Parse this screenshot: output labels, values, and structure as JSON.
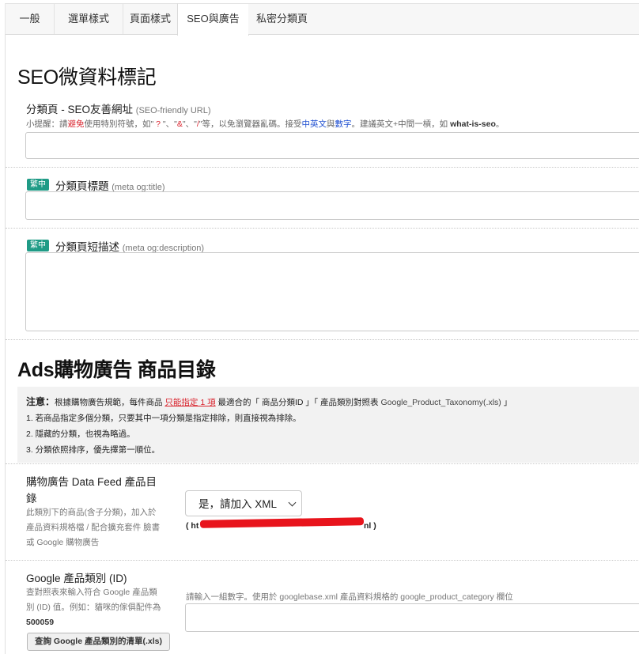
{
  "tabs": [
    {
      "label": "一般",
      "active": false
    },
    {
      "label": "選單樣式",
      "active": false
    },
    {
      "label": "頁面樣式",
      "active": false
    },
    {
      "label": "SEO與廣告",
      "active": true
    },
    {
      "label": "私密分類頁",
      "active": false
    }
  ],
  "seo": {
    "title": "SEO微資料標記",
    "friendly_url": {
      "label": "分類頁 - SEO友善網址",
      "sublabel": "(SEO-friendly URL)",
      "hint": {
        "p1": "小提醒：請",
        "avoid": "避免",
        "p2": "使用特別符號，如\"",
        "q": " ? ",
        "p3": "\"、\"",
        "amp": "&",
        "p4": "\"、\"",
        "slash": "/",
        "p5": "\"等，以免瀏覽器亂碼。接受",
        "cn": "中英文",
        "p6": "與",
        "num": "數字",
        "p7": "。建議英文+中間一槓，如 ",
        "example": "what-is-seo",
        "p8": "。"
      },
      "value": ""
    },
    "page_title": {
      "badge": "繁中",
      "label": "分類頁標題",
      "sublabel": "(meta og:title)",
      "value": ""
    },
    "page_desc": {
      "badge": "繁中",
      "label": "分類頁短描述",
      "sublabel": "(meta og:description)",
      "value": ""
    }
  },
  "ads": {
    "title": "Ads購物廣告 商品目錄",
    "notice": {
      "bold": "注意：",
      "line1a": "根據購物廣告規範，每件商品 ",
      "line1_link": "只能指定 1 項",
      "line1b": " 最適合的「 商品分類ID 」「 產品類別對照表 ",
      "line1_file": "Google_Product_Taxonomy(.xls)",
      "line1c": " 」",
      "line2": "1. 若商品指定多個分類，只要其中一項分類是指定排除，則直接視為排除。",
      "line3": "2. 隱藏的分類，也視為略過。",
      "line4": "3. 分類依照排序，優先擇第一順位。"
    },
    "datafeed": {
      "label_line1": "購物廣告 Data Feed 產品目",
      "label_line2": "錄",
      "desc_line1": "此類別下的商品(含子分類)，加入於",
      "desc_line2": "產品資料規格檔 / 配合擴充套件 臉書",
      "desc_line3": "或 Google 購物廣告",
      "select_value": "是，請加入 XML",
      "url_open": "( ",
      "url_prefix": "ht",
      "url_suffix": "nl",
      "url_close": " )"
    },
    "category": {
      "label": "Google 產品類別 (ID)",
      "desc_line1": "查對照表來輸入符合 Google 產品類",
      "desc_line2": "別 (ID) 值。例如：貓咪的傢俱配件為",
      "example_id": "500059",
      "button": "查詢 Google 產品類別的清單(.xls)",
      "hint": "請輸入一組數字。使用於 googlebase.xml 產品資料規格的 google_product_category 欄位",
      "value": ""
    }
  },
  "colors": {
    "badge": "#1f9b86",
    "warn": "#d9232d",
    "accent_blue": "#1f4fd1"
  }
}
